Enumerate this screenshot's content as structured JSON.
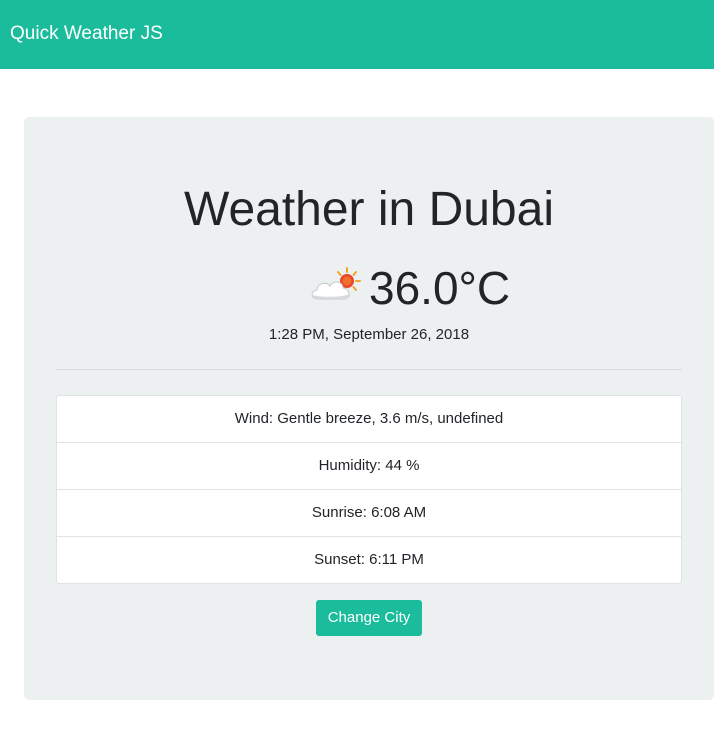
{
  "navbar": {
    "brand": "Quick Weather JS"
  },
  "weather": {
    "title": "Weather in Dubai",
    "icon": "partly-cloudy-sun-icon",
    "temperature": "36.0°C",
    "datetime": "1:28 PM, September 26, 2018",
    "details": [
      "Wind: Gentle breeze, 3.6 m/s, undefined",
      "Humidity: 44 %",
      "Sunrise: 6:08 AM",
      "Sunset: 6:11 PM"
    ]
  },
  "actions": {
    "change_city_label": "Change City"
  },
  "colors": {
    "primary": "#1abc9c",
    "panel_background": "#ecf0f1"
  }
}
